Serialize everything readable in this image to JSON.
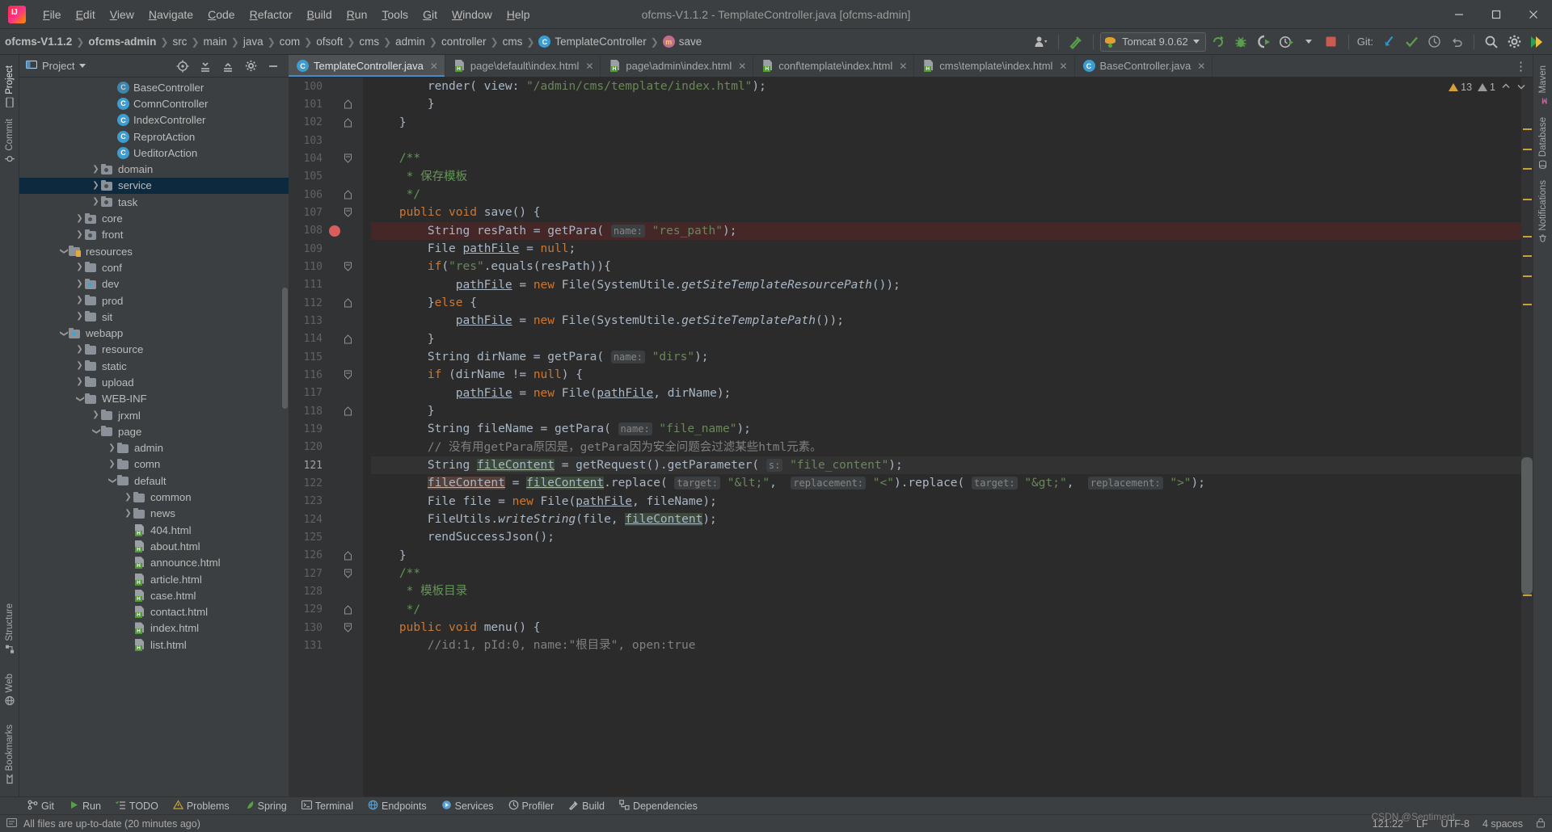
{
  "window": {
    "title": "ofcms-V1.1.2 - TemplateController.java [ofcms-admin]",
    "logo_label": "IJ",
    "minimize": "—",
    "maximize": "❐",
    "close": "✕"
  },
  "menu": {
    "items": [
      "File",
      "Edit",
      "View",
      "Navigate",
      "Code",
      "Refactor",
      "Build",
      "Run",
      "Tools",
      "Git",
      "Window",
      "Help"
    ]
  },
  "breadcrumbs": {
    "items": [
      {
        "label": "ofcms-V1.1.2",
        "bold": true,
        "icon": ""
      },
      {
        "label": "ofcms-admin",
        "bold": true,
        "icon": ""
      },
      {
        "label": "src",
        "bold": false,
        "icon": ""
      },
      {
        "label": "main",
        "bold": false,
        "icon": ""
      },
      {
        "label": "java",
        "bold": false,
        "icon": ""
      },
      {
        "label": "com",
        "bold": false,
        "icon": ""
      },
      {
        "label": "ofsoft",
        "bold": false,
        "icon": ""
      },
      {
        "label": "cms",
        "bold": false,
        "icon": ""
      },
      {
        "label": "admin",
        "bold": false,
        "icon": ""
      },
      {
        "label": "controller",
        "bold": false,
        "icon": ""
      },
      {
        "label": "cms",
        "bold": false,
        "icon": ""
      },
      {
        "label": "TemplateController",
        "bold": false,
        "icon": "class-icon",
        "icon_letter": "C"
      },
      {
        "label": "save",
        "bold": false,
        "icon": "method-icon",
        "icon_letter": "m"
      }
    ]
  },
  "toolbar": {
    "user_icon": "user-settings-icon",
    "hammer_icon": "build-hammer-icon",
    "run_config": {
      "name": "Tomcat 9.0.62",
      "icon": "tomcat-cat-icon"
    },
    "run_icon": "run-icon",
    "debug_icon": "debug-bug-icon",
    "run_coverage_icon": "run-with-coverage-icon",
    "profiler_icon": "profiler-icon",
    "stop_icon": "stop-icon",
    "git_label": "Git:",
    "git_update_icon": "update-project-icon",
    "git_commit_icon": "commit-checkmark-icon",
    "git_history_icon": "history-clock-icon",
    "git_rollback_icon": "rollback-icon",
    "search_icon": "search-everywhere-icon",
    "settings_icon": "gear-icon",
    "ide_icon": "ide-feature-icon"
  },
  "left_strip": {
    "tabs": [
      {
        "label": "Project",
        "icon": "project-icon",
        "active": true
      },
      {
        "label": "Commit",
        "icon": "commit-icon",
        "active": false
      },
      {
        "label": "Bookmarks",
        "icon": "bookmarks-icon",
        "active": false
      },
      {
        "label": "Web",
        "icon": "web-icon",
        "active": false
      },
      {
        "label": "Structure",
        "icon": "structure-icon",
        "active": false
      }
    ]
  },
  "right_strip": {
    "tabs": [
      {
        "label": "Maven",
        "icon": "maven-icon"
      },
      {
        "label": "Database",
        "icon": "database-icon"
      },
      {
        "label": "Notifications",
        "icon": "notifications-icon"
      }
    ]
  },
  "project_panel": {
    "title": "Project",
    "dropdown_icon": "chevron-down-icon",
    "toolbar_icons": [
      "locate-icon",
      "expand-all-icon",
      "collapse-all-icon",
      "settings-gear-icon",
      "hide-icon"
    ],
    "tree": [
      {
        "label": "BaseController",
        "type": "interface",
        "indent": 5,
        "arrow": "none",
        "selected": false
      },
      {
        "label": "ComnController",
        "type": "class",
        "indent": 5,
        "arrow": "none",
        "selected": false
      },
      {
        "label": "IndexController",
        "type": "class",
        "indent": 5,
        "arrow": "none",
        "selected": false
      },
      {
        "label": "ReprotAction",
        "type": "class",
        "indent": 5,
        "arrow": "none",
        "selected": false
      },
      {
        "label": "UeditorAction",
        "type": "class",
        "indent": 5,
        "arrow": "none",
        "selected": false
      },
      {
        "label": "domain",
        "type": "folder-src",
        "indent": 4,
        "arrow": "right",
        "selected": false
      },
      {
        "label": "service",
        "type": "folder-src",
        "indent": 4,
        "arrow": "right",
        "selected": true
      },
      {
        "label": "task",
        "type": "folder-src",
        "indent": 4,
        "arrow": "right",
        "selected": false
      },
      {
        "label": "core",
        "type": "folder-src",
        "indent": 3,
        "arrow": "right",
        "selected": false
      },
      {
        "label": "front",
        "type": "folder-src",
        "indent": 3,
        "arrow": "right",
        "selected": false
      },
      {
        "label": "resources",
        "type": "folder-res",
        "indent": 2,
        "arrow": "down",
        "selected": false
      },
      {
        "label": "conf",
        "type": "folder",
        "indent": 3,
        "arrow": "right",
        "selected": false
      },
      {
        "label": "dev",
        "type": "folder-blue",
        "indent": 3,
        "arrow": "right",
        "selected": false
      },
      {
        "label": "prod",
        "type": "folder",
        "indent": 3,
        "arrow": "right",
        "selected": false
      },
      {
        "label": "sit",
        "type": "folder",
        "indent": 3,
        "arrow": "right",
        "selected": false
      },
      {
        "label": "webapp",
        "type": "folder-blue",
        "indent": 2,
        "arrow": "down",
        "selected": false
      },
      {
        "label": "resource",
        "type": "folder",
        "indent": 3,
        "arrow": "right",
        "selected": false
      },
      {
        "label": "static",
        "type": "folder",
        "indent": 3,
        "arrow": "right",
        "selected": false
      },
      {
        "label": "upload",
        "type": "folder",
        "indent": 3,
        "arrow": "right",
        "selected": false
      },
      {
        "label": "WEB-INF",
        "type": "folder",
        "indent": 3,
        "arrow": "down",
        "selected": false
      },
      {
        "label": "jrxml",
        "type": "folder",
        "indent": 4,
        "arrow": "right",
        "selected": false
      },
      {
        "label": "page",
        "type": "folder",
        "indent": 4,
        "arrow": "down",
        "selected": false
      },
      {
        "label": "admin",
        "type": "folder",
        "indent": 5,
        "arrow": "right",
        "selected": false
      },
      {
        "label": "comn",
        "type": "folder",
        "indent": 5,
        "arrow": "right",
        "selected": false
      },
      {
        "label": "default",
        "type": "folder",
        "indent": 5,
        "arrow": "down",
        "selected": false
      },
      {
        "label": "common",
        "type": "folder",
        "indent": 6,
        "arrow": "right",
        "selected": false
      },
      {
        "label": "news",
        "type": "folder",
        "indent": 6,
        "arrow": "right",
        "selected": false
      },
      {
        "label": "404.html",
        "type": "html",
        "indent": 6,
        "arrow": "none",
        "selected": false
      },
      {
        "label": "about.html",
        "type": "html",
        "indent": 6,
        "arrow": "none",
        "selected": false
      },
      {
        "label": "announce.html",
        "type": "html",
        "indent": 6,
        "arrow": "none",
        "selected": false
      },
      {
        "label": "article.html",
        "type": "html",
        "indent": 6,
        "arrow": "none",
        "selected": false
      },
      {
        "label": "case.html",
        "type": "html",
        "indent": 6,
        "arrow": "none",
        "selected": false
      },
      {
        "label": "contact.html",
        "type": "html",
        "indent": 6,
        "arrow": "none",
        "selected": false
      },
      {
        "label": "index.html",
        "type": "html",
        "indent": 6,
        "arrow": "none",
        "selected": false
      },
      {
        "label": "list.html",
        "type": "html",
        "indent": 6,
        "arrow": "none",
        "selected": false
      }
    ]
  },
  "editor": {
    "tabs": [
      {
        "label": "TemplateController.java",
        "icon": "java-class-icon",
        "active": true
      },
      {
        "label": "page\\default\\index.html",
        "icon": "html-file-icon",
        "active": false
      },
      {
        "label": "page\\admin\\index.html",
        "icon": "html-file-icon",
        "active": false
      },
      {
        "label": "conf\\template\\index.html",
        "icon": "html-file-icon",
        "active": false
      },
      {
        "label": "cms\\template\\index.html",
        "icon": "html-file-icon",
        "active": false
      },
      {
        "label": "BaseController.java",
        "icon": "java-class-icon",
        "active": false
      }
    ],
    "tab_overflow_icon": "more-tabs-icon",
    "inspection": {
      "warnings": "13",
      "weak_warnings": "1",
      "up_icon": "previous-highlight-icon",
      "down_icon": "next-highlight-icon"
    },
    "first_line_number": 100,
    "breakpoint_line": 108,
    "caret_line": 121,
    "lines": [
      {
        "n": 100,
        "fold": "none",
        "text": "        render( view: \"/admin/cms/template/index.html\");"
      },
      {
        "n": 101,
        "fold": "end",
        "text": "        }"
      },
      {
        "n": 102,
        "fold": "end",
        "text": "    }"
      },
      {
        "n": 103,
        "fold": "none",
        "text": ""
      },
      {
        "n": 104,
        "fold": "start",
        "text": "    /**"
      },
      {
        "n": 105,
        "fold": "none",
        "text": "     * 保存模板"
      },
      {
        "n": 106,
        "fold": "end",
        "text": "     */"
      },
      {
        "n": 107,
        "fold": "start",
        "text": "    public void save() {"
      },
      {
        "n": 108,
        "fold": "none",
        "text": "        String resPath = getPara( name: \"res_path\");"
      },
      {
        "n": 109,
        "fold": "none",
        "text": "        File pathFile = null;"
      },
      {
        "n": 110,
        "fold": "start",
        "text": "        if(\"res\".equals(resPath)){"
      },
      {
        "n": 111,
        "fold": "none",
        "text": "            pathFile = new File(SystemUtile.getSiteTemplateResourcePath());"
      },
      {
        "n": 112,
        "fold": "end",
        "text": "        }else {"
      },
      {
        "n": 113,
        "fold": "none",
        "text": "            pathFile = new File(SystemUtile.getSiteTemplatePath());"
      },
      {
        "n": 114,
        "fold": "end",
        "text": "        }"
      },
      {
        "n": 115,
        "fold": "none",
        "text": "        String dirName = getPara( name: \"dirs\");"
      },
      {
        "n": 116,
        "fold": "start",
        "text": "        if (dirName != null) {"
      },
      {
        "n": 117,
        "fold": "none",
        "text": "            pathFile = new File(pathFile, dirName);"
      },
      {
        "n": 118,
        "fold": "end",
        "text": "        }"
      },
      {
        "n": 119,
        "fold": "none",
        "text": "        String fileName = getPara( name: \"file_name\");"
      },
      {
        "n": 120,
        "fold": "none",
        "text": "        // 没有用getPara原因是，getPara因为安全问题会过滤某些html元素。"
      },
      {
        "n": 121,
        "fold": "none",
        "text": "        String fileContent = getRequest().getParameter( s: \"file_content\");"
      },
      {
        "n": 122,
        "fold": "none",
        "text": "        fileContent = fileContent.replace( target: \"&lt;\",  replacement: \"<\").replace( target: \"&gt;\",  replacement: \">\");"
      },
      {
        "n": 123,
        "fold": "none",
        "text": "        File file = new File(pathFile, fileName);"
      },
      {
        "n": 124,
        "fold": "none",
        "text": "        FileUtils.writeString(file, fileContent);"
      },
      {
        "n": 125,
        "fold": "none",
        "text": "        rendSuccessJson();"
      },
      {
        "n": 126,
        "fold": "end",
        "text": "    }"
      },
      {
        "n": 127,
        "fold": "start",
        "text": "    /**"
      },
      {
        "n": 128,
        "fold": "none",
        "text": "     * 模板目录"
      },
      {
        "n": 129,
        "fold": "end",
        "text": "     */"
      },
      {
        "n": 130,
        "fold": "start",
        "text": "    public void menu() {"
      },
      {
        "n": 131,
        "fold": "none",
        "text": "        //id:1, pId:0, name:\"根目录\", open:true"
      }
    ]
  },
  "bottom_toolbar": {
    "items": [
      {
        "label": "Git",
        "icon": "git-branch-icon"
      },
      {
        "label": "Run",
        "icon": "run-play-icon"
      },
      {
        "label": "TODO",
        "icon": "todo-checklist-icon"
      },
      {
        "label": "Problems",
        "icon": "problems-warning-icon"
      },
      {
        "label": "Spring",
        "icon": "spring-leaf-icon"
      },
      {
        "label": "Terminal",
        "icon": "terminal-icon"
      },
      {
        "label": "Endpoints",
        "icon": "endpoints-icon"
      },
      {
        "label": "Services",
        "icon": "services-icon"
      },
      {
        "label": "Profiler",
        "icon": "profiler-icon"
      },
      {
        "label": "Build",
        "icon": "build-hammer-icon"
      },
      {
        "label": "Dependencies",
        "icon": "dependencies-icon"
      }
    ]
  },
  "status_bar": {
    "message_icon": "event-log-icon",
    "message": "All files are up-to-date (20 minutes ago)",
    "caret_position": "121:22",
    "line_separator": "LF",
    "encoding": "UTF-8",
    "indent": "4 spaces",
    "lock_icon": "lock-icon",
    "watermark": "CSDN @Sentiment"
  },
  "colors": {
    "accent_blue": "#4a88c7",
    "selection_bg": "#0d293e",
    "editor_bg": "#2b2b2b",
    "gutter_bg": "#313335",
    "panel_bg": "#3c3f41",
    "breakpoint_red": "#db5c5c",
    "warning_yellow": "#d6a13c",
    "keyword_orange": "#cc7832",
    "string_green": "#6a8759",
    "comment_grey": "#808080",
    "doc_green": "#629755"
  }
}
